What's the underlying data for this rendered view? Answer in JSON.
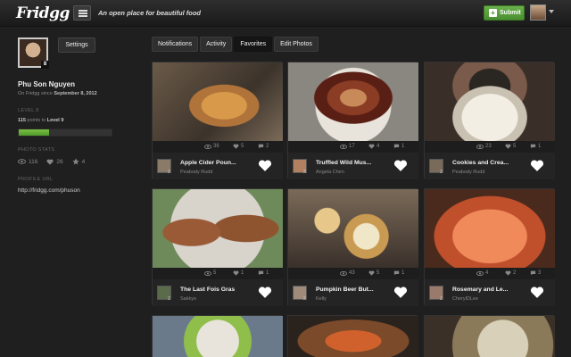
{
  "header": {
    "logo": "Fridgg",
    "tagline": "An open place for beautiful food",
    "submit_label": "Submit"
  },
  "profile": {
    "level_badge": "8",
    "settings_label": "Settings",
    "name": "Phu Son Nguyen",
    "since_prefix": "On Fridgg since",
    "since_date": "September 8, 2012",
    "level_label": "LEVEL 8",
    "points": "115",
    "points_text": "points to",
    "next_level": "Level 9",
    "progress_fraction": 0.33,
    "photo_stats_label": "PHOTO STATS",
    "stats": {
      "views": "116",
      "likes": "26",
      "stars": "4"
    },
    "profile_url_label": "PROFILE URL",
    "profile_url": "http://fridgg.com/phuson"
  },
  "tabs": [
    {
      "label": "Notifications",
      "active": false
    },
    {
      "label": "Activity",
      "active": false
    },
    {
      "label": "Favorites",
      "active": true
    },
    {
      "label": "Edit Photos",
      "active": false
    }
  ],
  "photos": [
    {
      "title": "Apple Cider Poun...",
      "author": "Peabody Rudd",
      "views": "36",
      "likes": "5",
      "comments": "2",
      "count": "2"
    },
    {
      "title": "Truffled Wild Mus...",
      "author": "Angela Chen",
      "views": "17",
      "likes": "4",
      "comments": "1",
      "count": "3"
    },
    {
      "title": "Cookies and Crea...",
      "author": "Peabody Rudd",
      "views": "23",
      "likes": "5",
      "comments": "1",
      "count": "2"
    },
    {
      "title": "The Last Fois Gras",
      "author": "Sakkyo",
      "views": "5",
      "likes": "1",
      "comments": "1",
      "count": "2"
    },
    {
      "title": "Pumpkin Beer But...",
      "author": "Kelly",
      "views": "43",
      "likes": "5",
      "comments": "1",
      "count": "2"
    },
    {
      "title": "Rosemary and Le...",
      "author": "CherylDLee",
      "views": "4",
      "likes": "2",
      "comments": "3",
      "count": "2"
    }
  ],
  "colors": {
    "accent_green": "#5aa13a",
    "background": "#1f1f1f"
  }
}
